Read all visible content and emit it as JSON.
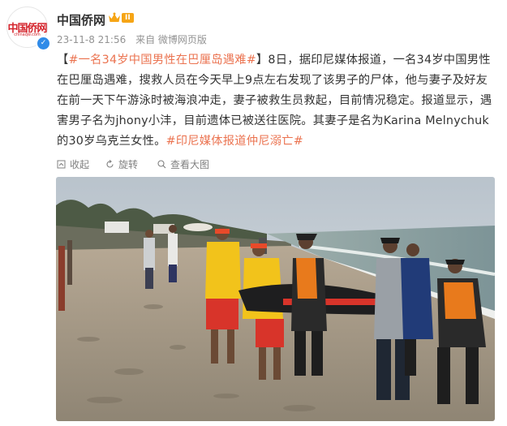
{
  "account": {
    "name": "中国侨网",
    "level_badge": "II",
    "avatar_logo": "中国侨网",
    "avatar_sub": "chinaqw.com"
  },
  "meta": {
    "time": "23-11-8 21:56",
    "source": "来自 微博网页版"
  },
  "post": {
    "hashtag_main": "#一名34岁中国男性在巴厘岛遇难#",
    "body": "8日，据印尼媒体报道，一名34岁中国男性在巴厘岛遇难，搜救人员在今天早上9点左右发现了该男子的尸体，他与妻子及好友在前一天下午游泳时被海浪冲走，妻子被救生员救起，目前情况稳定。报道显示，遇害男子名为jhony小沣，目前遗体已被送往医院。其妻子是名为Karina Melnychuk的30岁乌克兰女性。",
    "hashtag_end": "#印尼媒体报道仲尼溺亡#"
  },
  "toolbar": {
    "collapse": "收起",
    "rotate": "旋转",
    "view_large": "查看大图"
  },
  "colors": {
    "link": "#eb7350",
    "verified": "#2f8be8",
    "badge": "#f6a516"
  }
}
